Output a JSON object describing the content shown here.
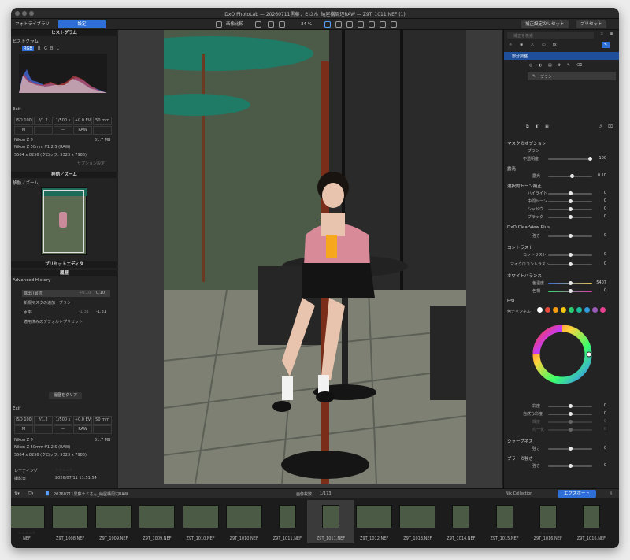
{
  "window": {
    "title": "DxO PhotoLab — 20260711黒藤ナミさん_納屋構周辺RAW — Z9T_1011.NEF (1)"
  },
  "toolbar": {
    "tab_library": "フォトライブラリ",
    "tab_customize": "設定",
    "compare_label": "画像比較",
    "zoom_label": "34 %",
    "reset_label": "補正設定のリセット",
    "preset_label": "プリセット"
  },
  "left": {
    "histogram_header": "ヒストグラム",
    "histogram_sub": "ヒストグラム",
    "channels": [
      "RGB",
      "R",
      "G",
      "B",
      "L"
    ],
    "exif_sub": "Exif",
    "exif_top": [
      "ISO 100",
      "f/1.2",
      "1/500 s",
      "+0.0 EV",
      "50 mm"
    ],
    "exif_bottom": [
      "M",
      "",
      "—",
      "RAW",
      ""
    ],
    "camera": "Nikon Z 9",
    "filesize": "51.7 MB",
    "lens": "Nikon Z 50mm f/1.2 S (RAW)",
    "dims": "5504 x 8256 (クロップ: 5323 x 7986)",
    "options_link": "サプション設定",
    "move_header": "移動／ズーム",
    "move_sub": "移動／ズーム",
    "preset_header": "プリセットエディタ",
    "history_header": "履歴",
    "history_sub": "Advanced History",
    "history_items": [
      {
        "label": "露出 (最初)",
        "from": "+0.10",
        "to": "0.10"
      },
      {
        "label": "新規マスクの追加・ブラシ",
        "from": "",
        "to": ""
      },
      {
        "label": "水平",
        "from": "-1.31",
        "to": "-1.31"
      },
      {
        "label": "適用済みのデフォルトプリセット",
        "from": "",
        "to": ""
      }
    ],
    "clear_history": "履歴をクリア",
    "exif2_sub": "Exif",
    "exif2_top": [
      "ISO 100",
      "f/1.2",
      "1/500 s",
      "+0.0 EV",
      "50 mm"
    ],
    "exif2_bottom": [
      "M",
      "",
      "—",
      "RAW",
      ""
    ],
    "camera2": "Nikon Z 9",
    "filesize2": "51.7 MB",
    "lens2": "Nikon Z 50mm f/1.2 S (RAW)",
    "dims2": "5504 x 8256 (クロップ: 5323 x 7986)",
    "rating_label": "レーティング",
    "date_label": "撮影日",
    "date_value": "2026/07/11 11:51:54"
  },
  "right": {
    "search_placeholder": "補正を検索",
    "local_adjust": "部分調整",
    "brush": "ブラシ",
    "mask_options": "マスクのオプション",
    "mask_brush": "ブラシ",
    "opacity_label": "不透明度",
    "opacity_value": "100",
    "exposure_sec": "露光",
    "exposure_label": "露光",
    "exposure_value": "0.10",
    "tone_sec": "選択的トーン補正",
    "tone_items": [
      {
        "label": "ハイライト",
        "value": "0"
      },
      {
        "label": "中間トーン",
        "value": "0"
      },
      {
        "label": "シャドウ",
        "value": "0"
      },
      {
        "label": "ブラック",
        "value": "0"
      }
    ],
    "clearview_sec": "DxO ClearView Plus",
    "clearview_label": "強さ",
    "clearview_value": "0",
    "contrast_sec": "コントラスト",
    "contrast_items": [
      {
        "label": "コントラスト",
        "value": "0"
      },
      {
        "label": "マイクロコントラスト",
        "value": "0"
      }
    ],
    "wb_sec": "ホワイトバランス",
    "wb_items": [
      {
        "label": "色温度",
        "value": "5407"
      },
      {
        "label": "色相",
        "value": "0"
      }
    ],
    "hsl_sec": "HSL",
    "hsl_channel": "色チャンネル",
    "hsl_colors": [
      "#ffffff",
      "#e74c3c",
      "#f39c12",
      "#f1c40f",
      "#2ecc71",
      "#1abc9c",
      "#3498db",
      "#9b59b6",
      "#e84393"
    ],
    "hsl_sliders": [
      {
        "label": "彩度",
        "value": "0"
      },
      {
        "label": "自然な彩度",
        "value": "0"
      },
      {
        "label": "輝度",
        "value": "0"
      },
      {
        "label": "均一化",
        "value": "0"
      }
    ],
    "sharp_sec": "シャープネス",
    "sharp_label": "強さ",
    "sharp_value": "0",
    "blur_sec": "ブラーの強さ",
    "blur_label": "強さ",
    "blur_value": "0"
  },
  "film": {
    "folder": "20260711黒藤ナミさん_納屋構周辺RAW",
    "count_label": "画像枚数：",
    "count_value": "1/173",
    "nik": "Nik Collection",
    "export": "エクスポート",
    "thumbs": [
      "NEF",
      "Z9T_1008.NEF",
      "Z9T_1009.NEF",
      "Z9T_1009.NEF",
      "Z9T_1010.NEF",
      "Z9T_1010.NEF",
      "Z9T_1011.NEF",
      "Z9T_1011.NEF",
      "Z9T_1012.NEF",
      "Z9T_1013.NEF",
      "Z9T_1014.NEF",
      "Z9T_1015.NEF",
      "Z9T_1016.NEF",
      "Z9T_1016.NEF"
    ]
  }
}
